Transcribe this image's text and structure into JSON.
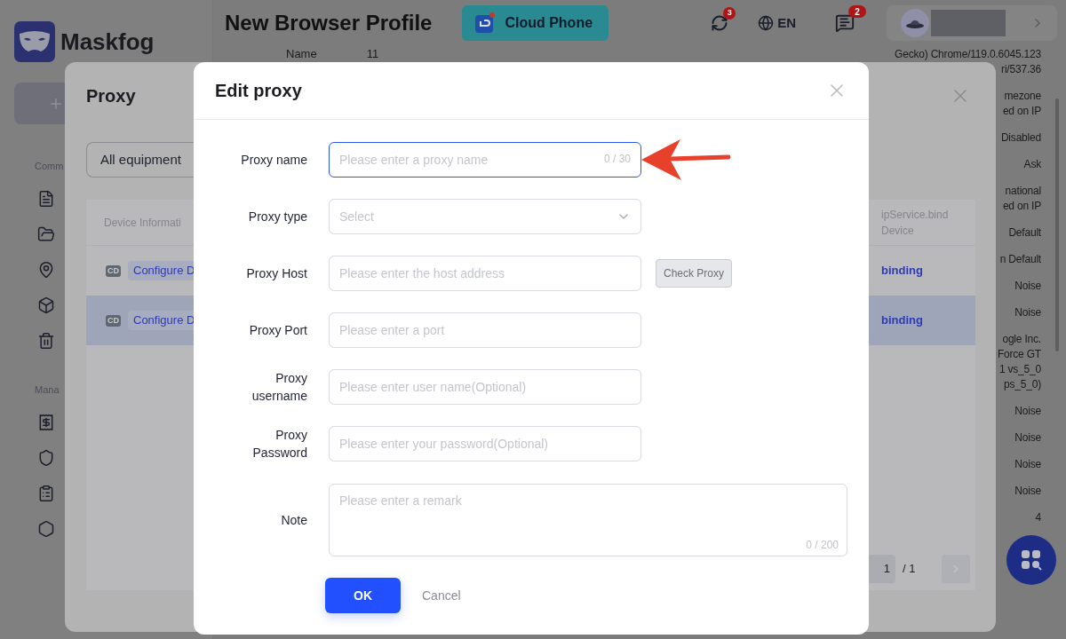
{
  "sidebar": {
    "brand": "Maskfog",
    "sections": [
      {
        "label": "Comm"
      },
      {
        "label": "Mana"
      }
    ]
  },
  "header": {
    "title": "New Browser Profile",
    "cloud_button": "Cloud Phone",
    "sync_badge": "3",
    "language": "EN",
    "messages_badge": "2"
  },
  "profile_details": {
    "name_label": "Name",
    "name_value": "11",
    "values": [
      [
        "Gecko) Chrome/119.0.6045.123",
        "ri/537.36"
      ],
      [
        "mezone",
        "ed on IP"
      ],
      [
        "Disabled"
      ],
      [
        "Ask"
      ],
      [
        "national",
        "ed on IP"
      ],
      [
        "Default"
      ],
      [
        "n Default"
      ],
      [
        "Noise"
      ],
      [
        "Noise"
      ],
      [
        "ogle Inc.",
        "Force GT",
        "1 vs_5_0",
        "ps_5_0)"
      ],
      [
        "Noise"
      ],
      [
        "Noise"
      ],
      [
        "Noise"
      ],
      [
        "Noise"
      ],
      [
        "4"
      ]
    ]
  },
  "proxy_dialog": {
    "title": "Proxy",
    "filter": "All equipment",
    "columns": [
      "Device Informati",
      "ipService.bind Device"
    ],
    "rows": [
      {
        "badge": "CD",
        "configure": "Configure D",
        "binding": "binding",
        "selected": false
      },
      {
        "badge": "CD",
        "configure": "Configure D",
        "binding": "binding",
        "selected": true
      }
    ],
    "pagination": {
      "page": "1",
      "total": "/ 1"
    }
  },
  "edit_dialog": {
    "title": "Edit proxy",
    "fields": [
      {
        "kind": "text",
        "label": "Proxy name",
        "placeholder": "Please enter a proxy name",
        "counter": "0 / 30",
        "focused": true
      },
      {
        "kind": "select",
        "label": "Proxy type",
        "placeholder": "Select",
        "focused": false
      },
      {
        "kind": "text",
        "label": "Proxy Host",
        "placeholder": "Please enter the host address",
        "action": "Check Proxy",
        "focused": false
      },
      {
        "kind": "text",
        "label": "Proxy Port",
        "placeholder": "Please enter a port",
        "focused": false
      },
      {
        "kind": "text",
        "label": "Proxy username",
        "placeholder": "Please enter user name(Optional)",
        "focused": false
      },
      {
        "kind": "text",
        "label": "Proxy Password",
        "placeholder": "Please enter your password(Optional)",
        "focused": false
      },
      {
        "kind": "textarea",
        "label": "Note",
        "placeholder": "Please enter a remark",
        "counter": "0 / 200",
        "focused": false
      }
    ],
    "buttons": {
      "ok": "OK",
      "cancel": "Cancel"
    }
  }
}
